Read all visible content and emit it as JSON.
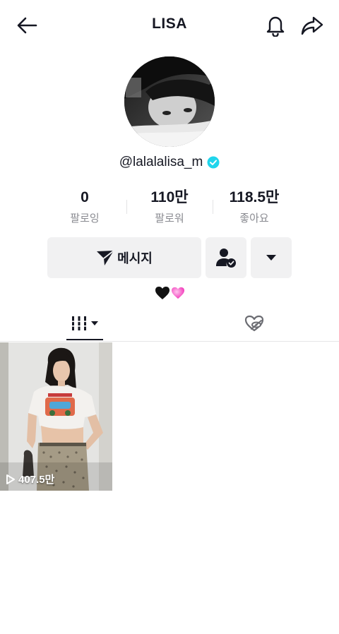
{
  "header": {
    "title": "LISA",
    "back_icon": "arrow-left-icon",
    "bell_icon": "bell-icon",
    "share_icon": "share-arrow-icon"
  },
  "profile": {
    "username": "@lalalalisa_m",
    "verified": true,
    "bio": "🖤💗"
  },
  "stats": [
    {
      "value": "0",
      "label": "팔로잉"
    },
    {
      "value": "110만",
      "label": "팔로워"
    },
    {
      "value": "118.5만",
      "label": "좋아요"
    }
  ],
  "actions": {
    "message_label": "메시지",
    "message_icon": "send-icon",
    "follow_icon": "user-check-icon",
    "more_icon": "caret-down-icon"
  },
  "tabs": {
    "videos_icon": "grid-lines-icon",
    "liked_icon": "hidden-heart-icon"
  },
  "videos": [
    {
      "views": "407.5만"
    }
  ],
  "colors": {
    "accent_verified": "#20d5ec",
    "text_primary": "#161823",
    "text_secondary": "#8a8b91",
    "button_bg": "#f1f1f2"
  }
}
